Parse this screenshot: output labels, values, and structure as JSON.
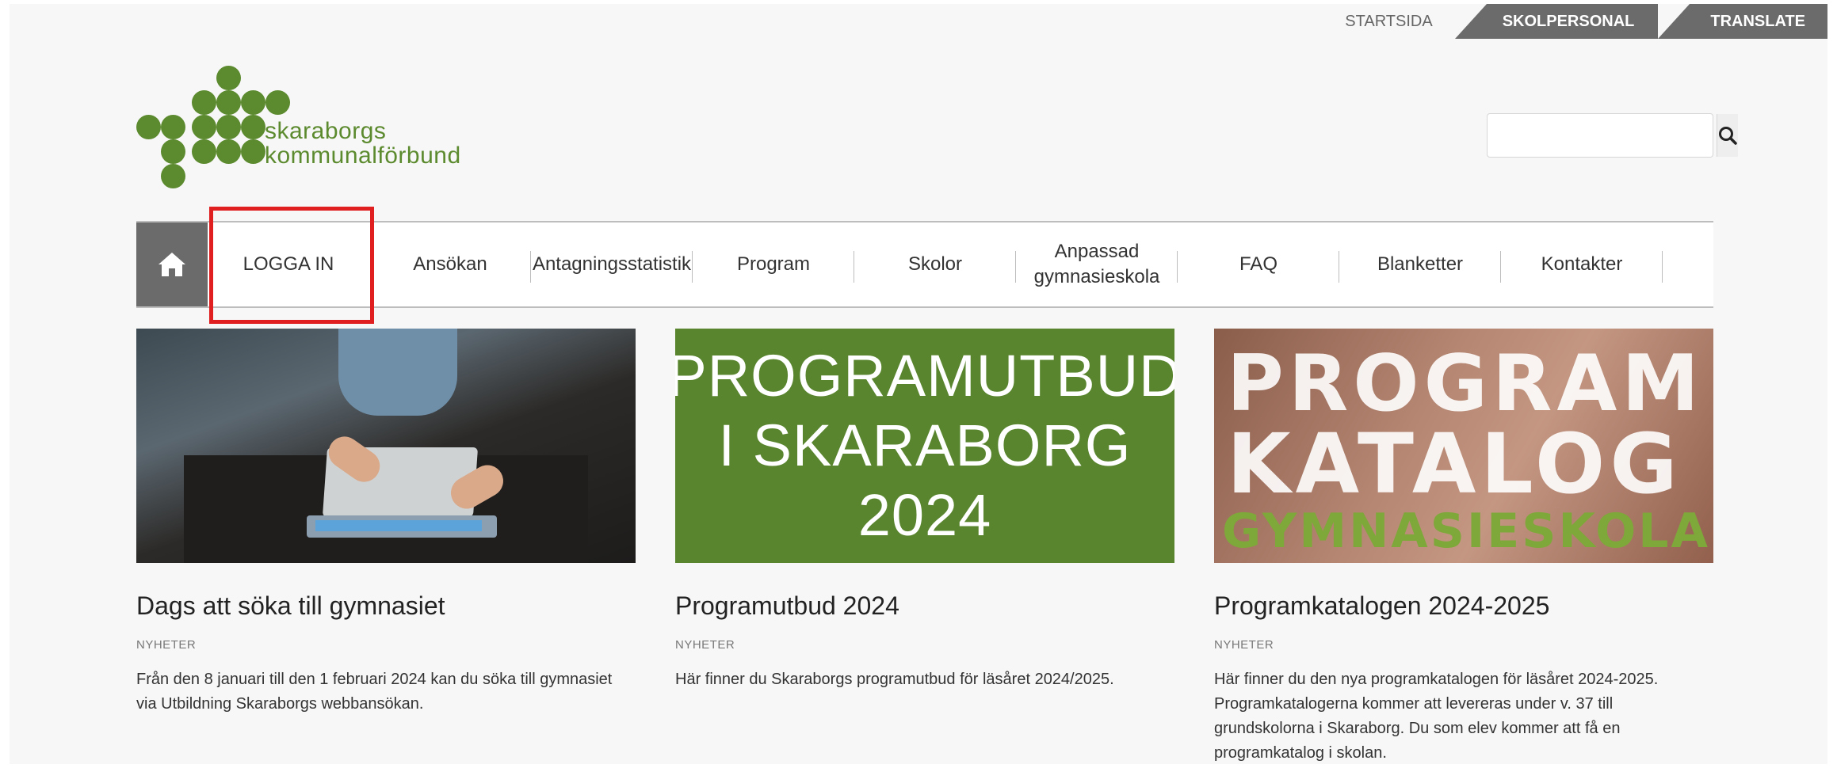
{
  "top_links": {
    "start": "STARTSIDA",
    "staff": "SKOLPERSONAL",
    "translate": "TRANSLATE"
  },
  "logo": {
    "line1": "skaraborgs",
    "line2": "kommunalförbund"
  },
  "search": {
    "value": "",
    "placeholder": "",
    "icon": "search-icon"
  },
  "nav": {
    "home_icon": "home-icon",
    "items": [
      "LOGGA IN",
      "Ansökan",
      "Antagningsstatistik",
      "Program",
      "Skolor",
      "Anpassad gymnasieskola",
      "FAQ",
      "Blanketter",
      "Kontakter"
    ]
  },
  "cards": [
    {
      "title": "Dags att söka till gymnasiet",
      "category": "NYHETER",
      "text": "Från den 8 januari till den 1 februari 2024 kan du söka till gymnasiet via Utbildning Skaraborgs webbansökan."
    },
    {
      "title": "Programutbud 2024",
      "category": "NYHETER",
      "text": "Här finner du Skaraborgs programutbud för läsåret 2024/2025.",
      "image_lines": [
        "PROGRAMUTBUD",
        "I SKARABORG",
        "2024"
      ]
    },
    {
      "title": "Programkatalogen 2024-2025",
      "category": "NYHETER",
      "text": "Här finner du den nya programkatalogen för läsåret 2024-2025. Programkatalogerna kommer att levereras under v. 37 till grundskolorna i Skaraborg. Du som elev kommer att få en programkatalog i skolan.",
      "image_lines": [
        "PROGRAM",
        "KATALOG",
        "GYMNASIESKOLAN"
      ]
    }
  ],
  "colors": {
    "brand_green": "#5c8a2e",
    "nav_dark": "#6b6b6b",
    "highlight": "#e02020"
  }
}
